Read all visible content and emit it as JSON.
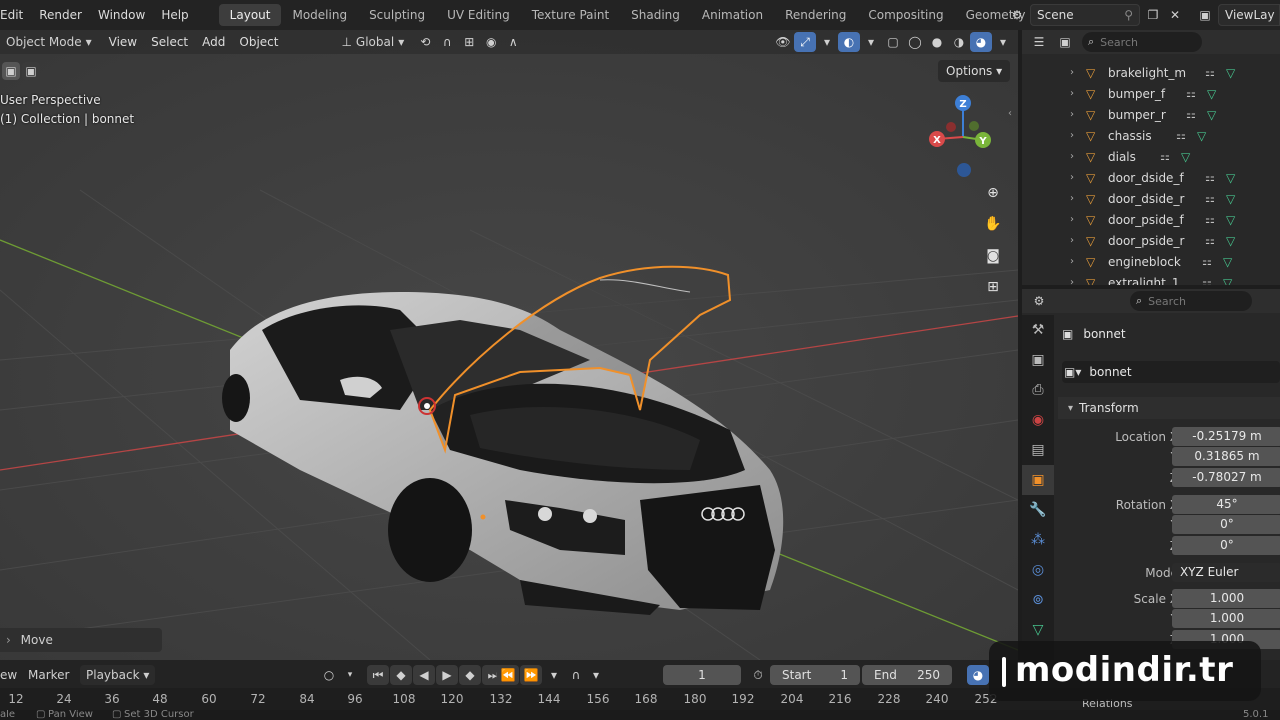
{
  "topbar": {
    "menus": [
      "Edit",
      "Render",
      "Window",
      "Help"
    ],
    "workspaces": [
      "Layout",
      "Modeling",
      "Sculpting",
      "UV Editing",
      "Texture Paint",
      "Shading",
      "Animation",
      "Rendering",
      "Compositing",
      "Geometry Node"
    ],
    "active_workspace": "Layout",
    "scene": "Scene",
    "view_layer": "ViewLay"
  },
  "viewport": {
    "mode": "Object Mode",
    "menus": [
      "View",
      "Select",
      "Add",
      "Object"
    ],
    "orientation": "Global",
    "overlay_line1": "User Perspective",
    "overlay_line2": "(1) Collection | bonnet",
    "options_label": "Options",
    "last_operator": "Move",
    "gizmo": {
      "x": "X",
      "y": "Y",
      "z": "Z"
    }
  },
  "outliner": {
    "search_placeholder": "Search",
    "items": [
      "brakelight_m",
      "bumper_f",
      "bumper_r",
      "chassis",
      "dials",
      "door_dside_f",
      "door_dside_r",
      "door_pside_f",
      "door_pside_r",
      "engineblock",
      "extralight_1"
    ]
  },
  "properties": {
    "search_placeholder": "Search",
    "object_title": "bonnet",
    "object_name": "bonnet",
    "section_transform": "Transform",
    "location_label": "Location X",
    "location": {
      "x": "-0.25179 m",
      "y": "0.31865 m",
      "z": "-0.78027 m"
    },
    "rotation_label": "Rotation X",
    "rotation": {
      "x": "45°",
      "y": "0°",
      "z": "0°"
    },
    "mode_label": "Mode",
    "rotation_mode": "XYZ Euler",
    "scale_label": "Scale X",
    "scale": {
      "x": "1.000",
      "y": "1.000",
      "z": "1.000"
    },
    "axis_y": "Y",
    "axis_z": "Z",
    "section_relations": "Relations"
  },
  "timeline": {
    "menus": [
      "ew",
      "Marker",
      "Playback"
    ],
    "current_frame": "1",
    "start_label": "Start",
    "start": "1",
    "end_label": "End",
    "end": "250",
    "ticks": [
      "12",
      "24",
      "36",
      "48",
      "60",
      "72",
      "84",
      "96",
      "108",
      "120",
      "132",
      "144",
      "156",
      "168",
      "180",
      "192",
      "204",
      "216",
      "228",
      "240",
      "252"
    ],
    "status_left": "ale",
    "status_mid": "Pan View",
    "status_right": "Set 3D Cursor",
    "version": "5.0.1"
  },
  "watermark": "modindir.tr",
  "colors": {
    "selection_outline": "#f0902a",
    "x_axis": "#d94a4a",
    "y_axis": "#7ab53a",
    "z_axis": "#3d7fd6",
    "active_blue": "#4772b3",
    "mesh_green": "#47c38d"
  }
}
